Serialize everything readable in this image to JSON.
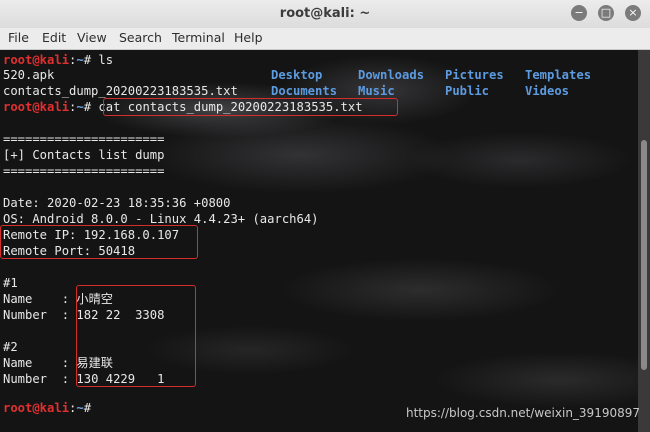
{
  "window": {
    "title": "root@kali: ~",
    "buttons": [
      "−",
      "□",
      "×"
    ]
  },
  "menu": [
    "File",
    "Edit",
    "View",
    "Search",
    "Terminal",
    "Help"
  ],
  "prompt": {
    "user": "root@kali",
    "path": "~",
    "symbol": "#"
  },
  "commands": {
    "ls": "ls",
    "cat": "cat contacts_dump_20200223183535.txt"
  },
  "ls_output": {
    "files": [
      "520.apk",
      "contacts_dump_20200223183535.txt"
    ],
    "dirs": [
      [
        "Desktop",
        "Downloads",
        "Pictures",
        "Templates"
      ],
      [
        "Documents",
        "Music",
        "Public",
        "Videos"
      ]
    ]
  },
  "dump": {
    "separator": "======================",
    "header": "[+] Contacts list dump",
    "date": "Date: 2020-02-23 18:35:36 +0800",
    "os": "OS: Android 8.0.0 - Linux 4.4.23+ (aarch64)",
    "remote_ip": "Remote IP: 192.168.0.107",
    "remote_port": "Remote Port: 50418",
    "contacts": [
      {
        "index": "#1",
        "name_label": "Name    :",
        "name": "小晴空",
        "number_label": "Number  :",
        "number": "182 22  3308"
      },
      {
        "index": "#2",
        "name_label": "Name    :",
        "name": "易建联",
        "number_label": "Number  :",
        "number": "130 4229   1"
      }
    ]
  },
  "watermark": "https://blog.csdn.net/weixin_39190897"
}
